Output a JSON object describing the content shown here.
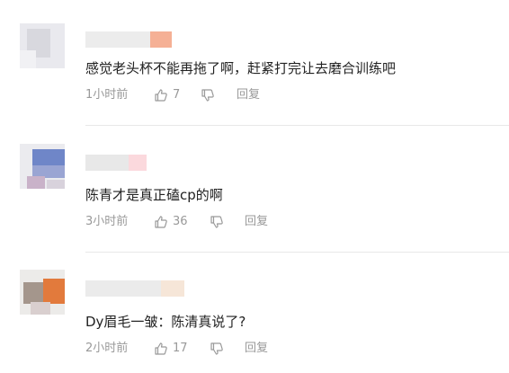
{
  "comments": [
    {
      "text": "感觉老头杯不能再拖了啊，赶紧打完让去磨合训练吧",
      "time": "1小时前",
      "likes": "7",
      "reply_label": "回复"
    },
    {
      "text": "陈青才是真正磕cp的啊",
      "time": "3小时前",
      "likes": "36",
      "reply_label": "回复"
    },
    {
      "text": "Dy眉毛一皱：陈清真说了?",
      "time": "2小时前",
      "likes": "17",
      "reply_label": "回复"
    }
  ],
  "icons": {
    "like": "thumbs-up-icon",
    "dislike": "thumbs-down-icon"
  },
  "colors": {
    "text": "#222222",
    "meta": "#999999",
    "divider": "#e8e8e8"
  }
}
